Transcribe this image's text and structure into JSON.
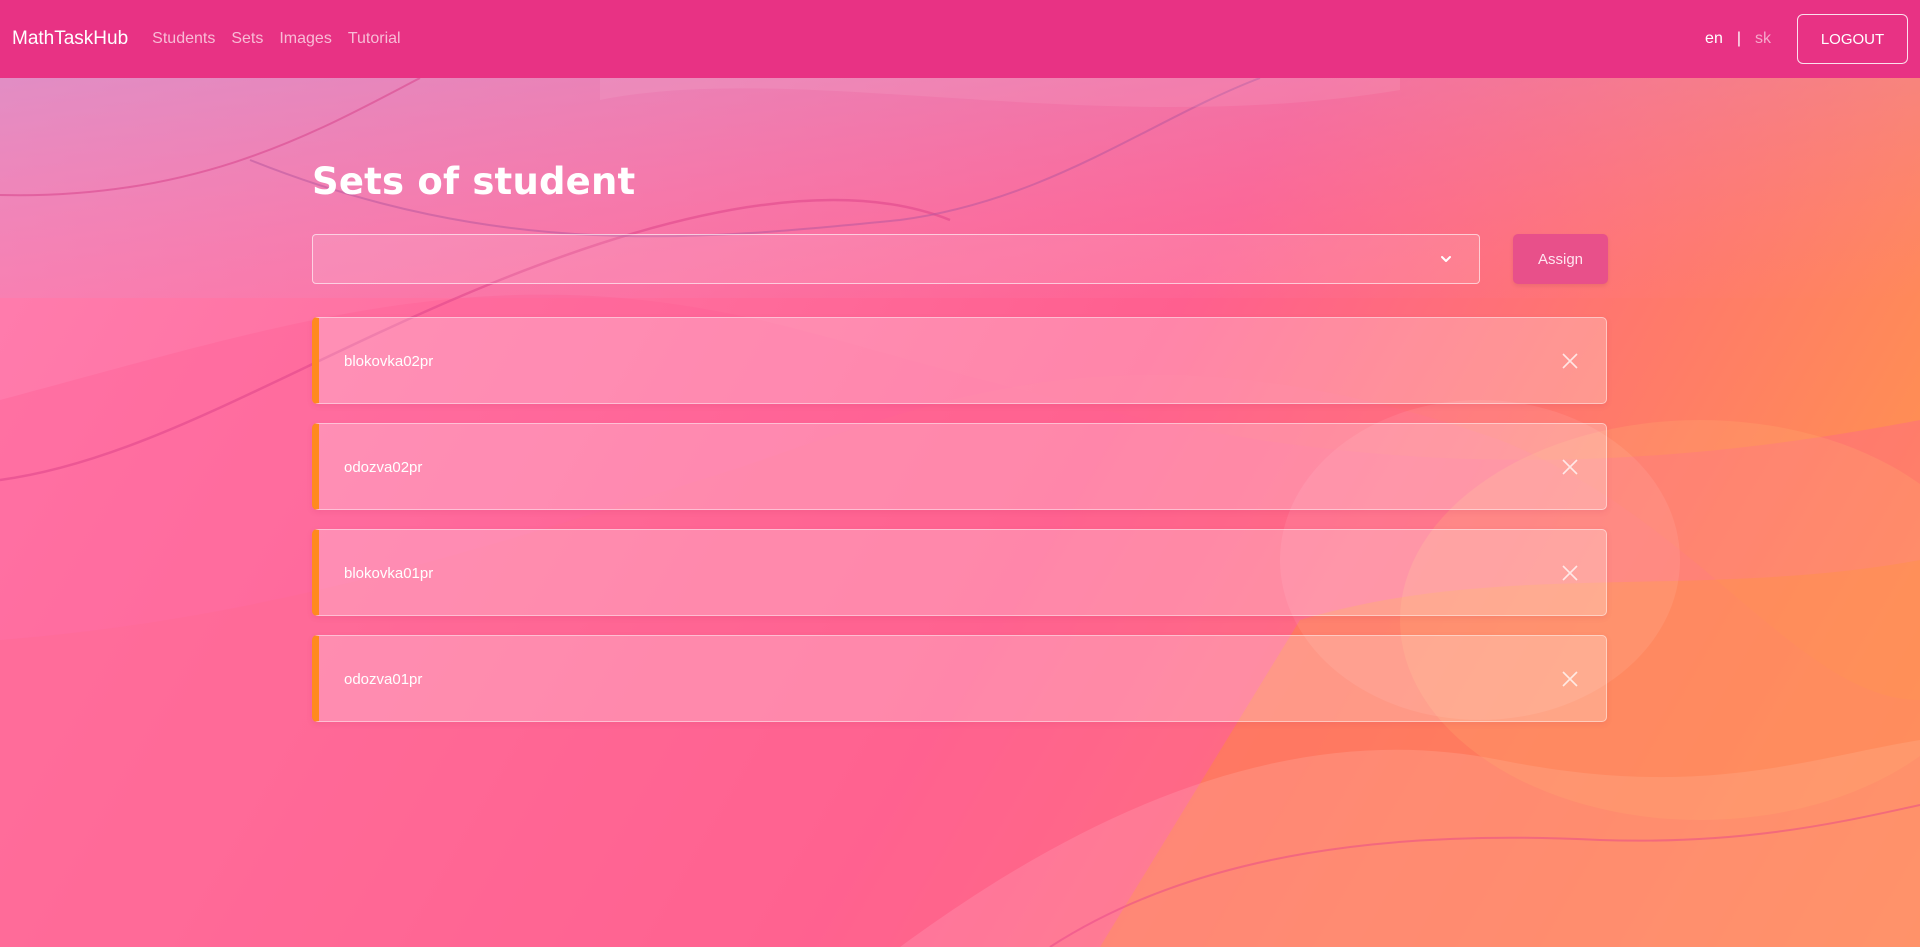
{
  "navbar": {
    "brand": "MathTaskHub",
    "links": [
      {
        "label": "Students"
      },
      {
        "label": "Sets"
      },
      {
        "label": "Images"
      },
      {
        "label": "Tutorial"
      }
    ],
    "languages": {
      "en": "en",
      "separator": "|",
      "sk": "sk"
    },
    "logout_label": "LOGOUT"
  },
  "main": {
    "title": "Sets of student",
    "select": {
      "value": ""
    },
    "assign_label": "Assign",
    "sets": [
      {
        "name": "blokovka02pr"
      },
      {
        "name": "odozva02pr"
      },
      {
        "name": "blokovka01pr"
      },
      {
        "name": "odozva01pr"
      }
    ]
  },
  "colors": {
    "navbar": "#e83284",
    "accent_border": "#ff8a1e",
    "assign_button": "#e8508a"
  },
  "icons": {
    "dropdown": "chevron-down-icon",
    "remove": "close-icon"
  }
}
